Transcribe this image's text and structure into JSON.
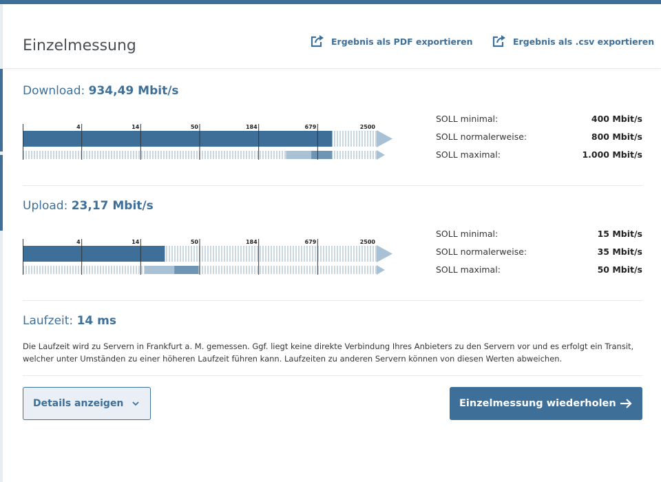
{
  "header": {
    "title": "Einzelmessung",
    "export_pdf_label": "Ergebnis als PDF exportieren",
    "export_csv_label": "Ergebnis als .csv exportieren"
  },
  "download": {
    "label": "Download:",
    "value": "934,49 Mbit/s",
    "measured_fraction": 0.8743,
    "soll_range_fraction": [
      0.7438,
      0.8743
    ],
    "soll": [
      {
        "label": "SOLL minimal:",
        "value": "400 Mbit/s"
      },
      {
        "label": "SOLL normalerweise:",
        "value": "800 Mbit/s"
      },
      {
        "label": "SOLL maximal:",
        "value": "1.000 Mbit/s"
      }
    ]
  },
  "upload": {
    "label": "Upload:",
    "value": "23,17 Mbit/s",
    "measured_fraction": 0.4016,
    "soll_range_fraction": [
      0.3446,
      0.4972
    ],
    "soll": [
      {
        "label": "SOLL minimal:",
        "value": "15 Mbit/s"
      },
      {
        "label": "SOLL normalerweise:",
        "value": "35 Mbit/s"
      },
      {
        "label": "SOLL maximal:",
        "value": "50 Mbit/s"
      }
    ]
  },
  "scale_ticks": [
    "4",
    "14",
    "50",
    "184",
    "679",
    "2500"
  ],
  "latency": {
    "label": "Laufzeit:",
    "value": "14 ms",
    "description": "Die Laufzeit wird zu Servern in Frankfurt a. M. gemessen. Ggf. liegt keine direkte Verbindung Ihres Anbieters zu den Servern vor und es erfolgt ein Transit, welcher unter Umständen zu einer höheren Laufzeit führen kann. Laufzeiten zu anderen Servern können von diesen Werten abweichen."
  },
  "buttons": {
    "details": "Details anzeigen",
    "repeat": "Einzelmessung wiederholen"
  },
  "colors": {
    "accent": "#3d6f99",
    "bar_track": "#c9d7e3",
    "soll_light": "#a9c1d5",
    "soll_dark": "#6f95b5"
  },
  "icons": {
    "export": "export-icon",
    "chevron": "chevron-down-icon",
    "arrow": "arrow-right-icon"
  }
}
